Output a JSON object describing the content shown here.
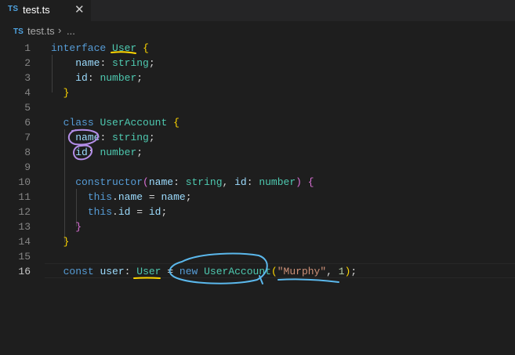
{
  "tab": {
    "badge": "TS",
    "label": "test.ts",
    "close": "✕"
  },
  "breadcrumb": {
    "badge": "TS",
    "file": "test.ts",
    "separator": "›",
    "ellipsis": "..."
  },
  "editor": {
    "active_line": 16,
    "lines": [
      {
        "n": "1",
        "t": [
          [
            "kw",
            "interface"
          ],
          [
            "pu",
            " "
          ],
          [
            "ty",
            "User"
          ],
          [
            "pu",
            " "
          ],
          [
            "b1",
            "{"
          ]
        ]
      },
      {
        "n": "2",
        "t": [
          [
            "pu",
            "    "
          ],
          [
            "pr",
            "name"
          ],
          [
            "pu",
            ": "
          ],
          [
            "ty",
            "string"
          ],
          [
            "pu",
            ";"
          ]
        ]
      },
      {
        "n": "3",
        "t": [
          [
            "pu",
            "    "
          ],
          [
            "pr",
            "id"
          ],
          [
            "pu",
            ": "
          ],
          [
            "ty",
            "number"
          ],
          [
            "pu",
            ";"
          ]
        ]
      },
      {
        "n": "4",
        "t": [
          [
            "pu",
            "  "
          ],
          [
            "b1",
            "}"
          ]
        ]
      },
      {
        "n": "5",
        "t": []
      },
      {
        "n": "6",
        "t": [
          [
            "pu",
            "  "
          ],
          [
            "kw",
            "class"
          ],
          [
            "pu",
            " "
          ],
          [
            "ty",
            "UserAccount"
          ],
          [
            "pu",
            " "
          ],
          [
            "b1",
            "{"
          ]
        ]
      },
      {
        "n": "7",
        "t": [
          [
            "pu",
            "    "
          ],
          [
            "pr",
            "name"
          ],
          [
            "pu",
            ": "
          ],
          [
            "ty",
            "string"
          ],
          [
            "pu",
            ";"
          ]
        ]
      },
      {
        "n": "8",
        "t": [
          [
            "pu",
            "    "
          ],
          [
            "pr",
            "id"
          ],
          [
            "pu",
            ": "
          ],
          [
            "ty",
            "number"
          ],
          [
            "pu",
            ";"
          ]
        ]
      },
      {
        "n": "9",
        "t": []
      },
      {
        "n": "10",
        "t": [
          [
            "pu",
            "    "
          ],
          [
            "kw",
            "constructor"
          ],
          [
            "b2",
            "("
          ],
          [
            "pr",
            "name"
          ],
          [
            "pu",
            ": "
          ],
          [
            "ty",
            "string"
          ],
          [
            "pu",
            ", "
          ],
          [
            "pr",
            "id"
          ],
          [
            "pu",
            ": "
          ],
          [
            "ty",
            "number"
          ],
          [
            "b2",
            ")"
          ],
          [
            "pu",
            " "
          ],
          [
            "b2",
            "{"
          ]
        ]
      },
      {
        "n": "11",
        "t": [
          [
            "pu",
            "      "
          ],
          [
            "kw",
            "this"
          ],
          [
            "pu",
            "."
          ],
          [
            "pr",
            "name"
          ],
          [
            "pu",
            " = "
          ],
          [
            "pr",
            "name"
          ],
          [
            "pu",
            ";"
          ]
        ]
      },
      {
        "n": "12",
        "t": [
          [
            "pu",
            "      "
          ],
          [
            "kw",
            "this"
          ],
          [
            "pu",
            "."
          ],
          [
            "pr",
            "id"
          ],
          [
            "pu",
            " = "
          ],
          [
            "pr",
            "id"
          ],
          [
            "pu",
            ";"
          ]
        ]
      },
      {
        "n": "13",
        "t": [
          [
            "pu",
            "    "
          ],
          [
            "b2",
            "}"
          ]
        ]
      },
      {
        "n": "14",
        "t": [
          [
            "pu",
            "  "
          ],
          [
            "b1",
            "}"
          ]
        ]
      },
      {
        "n": "15",
        "t": []
      },
      {
        "n": "16",
        "t": [
          [
            "pu",
            "  "
          ],
          [
            "kw",
            "const"
          ],
          [
            "pu",
            " "
          ],
          [
            "pr",
            "user"
          ],
          [
            "pu",
            ": "
          ],
          [
            "ty",
            "User"
          ],
          [
            "pu",
            " = "
          ],
          [
            "kw",
            "new"
          ],
          [
            "pu",
            " "
          ],
          [
            "ty",
            "UserAccount"
          ],
          [
            "b1",
            "("
          ],
          [
            "st",
            "\"Murphy\""
          ],
          [
            "pu",
            ", "
          ],
          [
            "nu",
            "1"
          ],
          [
            "b1",
            ")"
          ],
          [
            "pu",
            ";"
          ]
        ]
      }
    ]
  },
  "colors": {
    "background": "#1e1e1e",
    "keyword": "#569cd6",
    "type": "#4ec9b0",
    "property": "#9cdcfe",
    "string": "#ce9178",
    "number": "#b5cea8",
    "bracket_gold": "#ffd700",
    "bracket_orchid": "#da70d6",
    "annotation_yellow": "#ffd700",
    "annotation_blue": "#5bb8ec",
    "annotation_purple": "#b48ee8"
  },
  "icons": {
    "tab_close": "close-icon",
    "breadcrumb_separator": "chevron-right-icon"
  }
}
